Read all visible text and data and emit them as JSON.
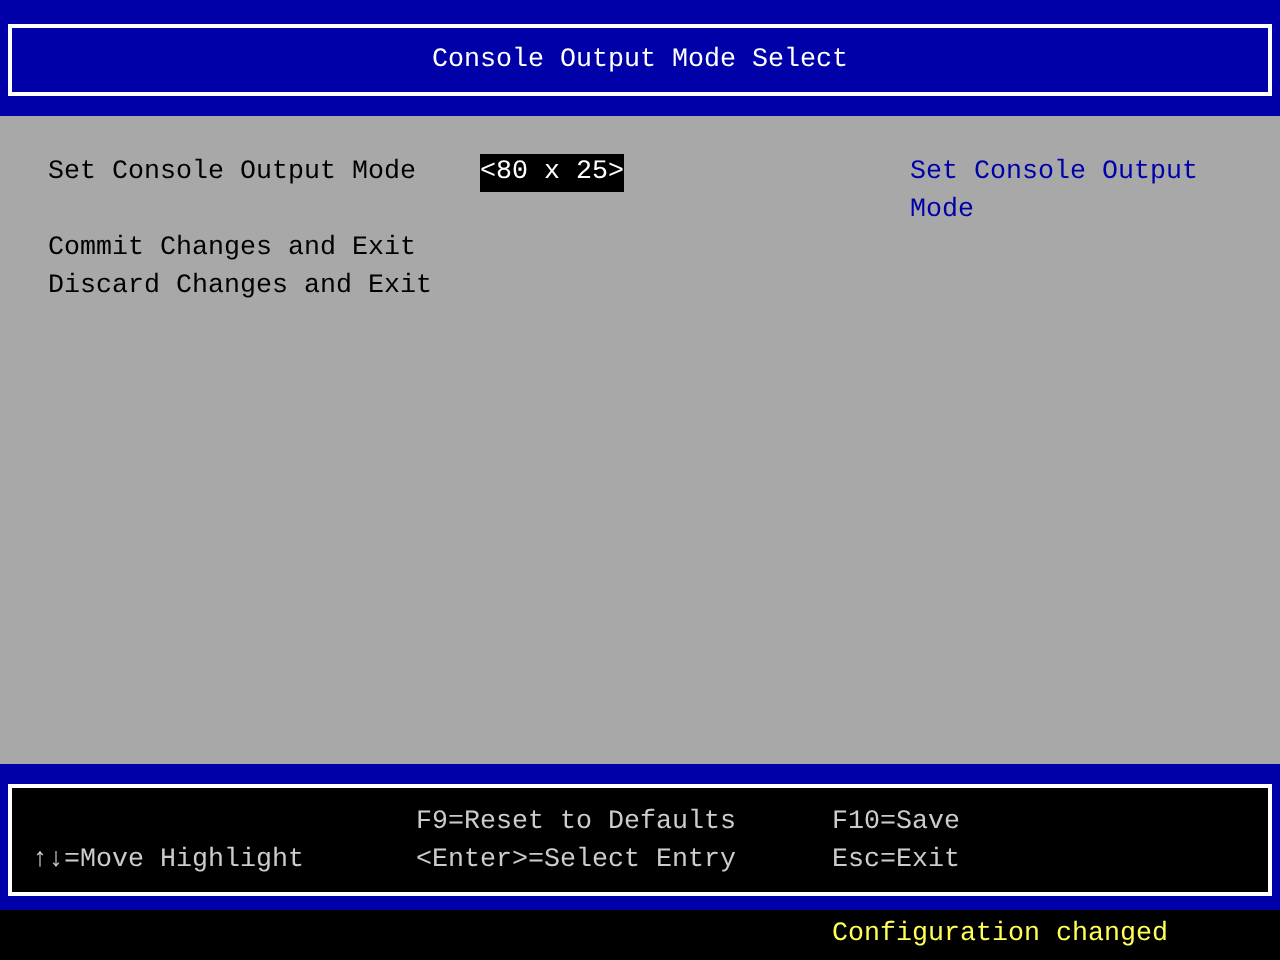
{
  "title": "Console Output Mode Select",
  "items": [
    {
      "kind": "option",
      "label": "Set Console Output Mode",
      "value": "<80 x 25>",
      "selected": true
    },
    {
      "kind": "action",
      "label": "Commit Changes and Exit",
      "selected": false
    },
    {
      "kind": "action",
      "label": "Discard Changes and Exit",
      "selected": false
    }
  ],
  "help": "Set Console Output Mode",
  "key_columns": [
    [
      "↑↓=Move Highlight"
    ],
    [
      "F9=Reset to Defaults",
      "<Enter>=Select Entry"
    ],
    [
      "F10=Save",
      "Esc=Exit"
    ]
  ],
  "status": "Configuration changed"
}
